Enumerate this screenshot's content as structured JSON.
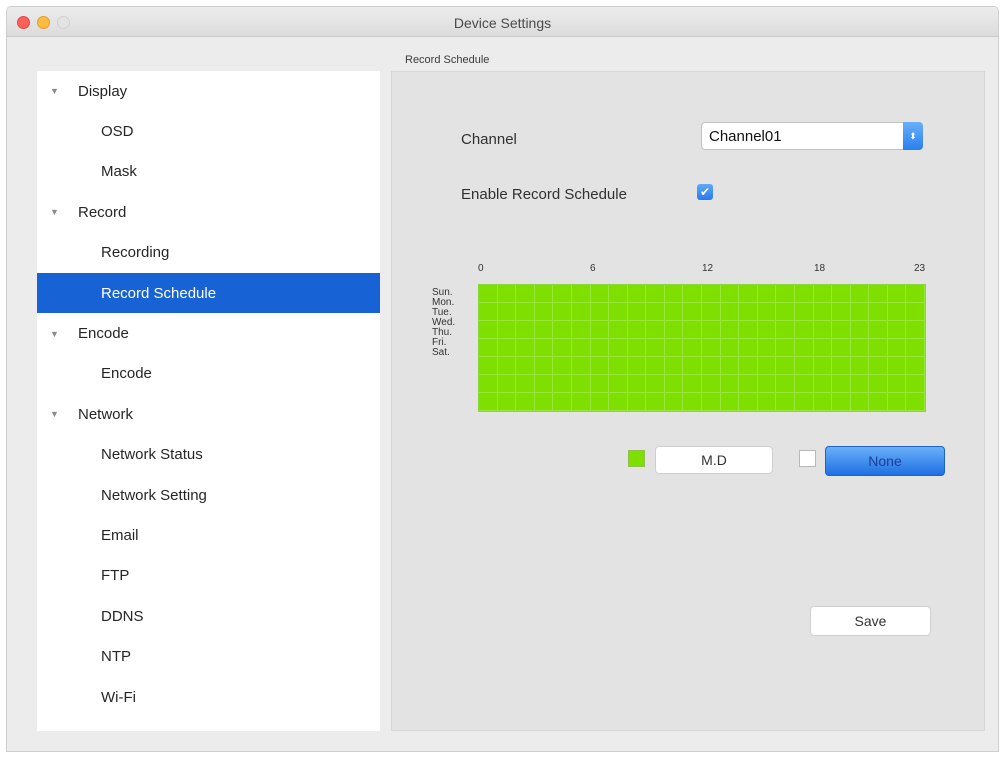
{
  "window": {
    "title": "Device Settings"
  },
  "sidebar": {
    "items": [
      {
        "label": "Display",
        "type": "group",
        "disclosure": "▼"
      },
      {
        "label": "OSD",
        "type": "child"
      },
      {
        "label": "Mask",
        "type": "child"
      },
      {
        "label": "Record",
        "type": "group",
        "disclosure": "▼"
      },
      {
        "label": "Recording",
        "type": "child"
      },
      {
        "label": "Record Schedule",
        "type": "child",
        "selected": true
      },
      {
        "label": "Encode",
        "type": "group",
        "disclosure": "▼"
      },
      {
        "label": "Encode",
        "type": "child"
      },
      {
        "label": "Network",
        "type": "group",
        "disclosure": "▼"
      },
      {
        "label": "Network Status",
        "type": "child"
      },
      {
        "label": "Network Setting",
        "type": "child"
      },
      {
        "label": "Email",
        "type": "child"
      },
      {
        "label": "FTP",
        "type": "child"
      },
      {
        "label": "DDNS",
        "type": "child"
      },
      {
        "label": "NTP",
        "type": "child"
      },
      {
        "label": "Wi-Fi",
        "type": "child"
      }
    ]
  },
  "main": {
    "group_label": "Record Schedule",
    "channel_label": "Channel",
    "channel_value": "Channel01",
    "enable_label": "Enable Record Schedule",
    "enable_checked": true,
    "schedule": {
      "hour_labels": [
        "0",
        "6",
        "12",
        "18",
        "23"
      ],
      "days": [
        "Sun.",
        "Mon.",
        "Tue.",
        "Wed.",
        "Thu.",
        "Fri.",
        "Sat."
      ],
      "hours": 24,
      "active_color": "#7fe000"
    },
    "legend": {
      "md_label": "M.D",
      "none_label": "None"
    },
    "save_label": "Save"
  }
}
